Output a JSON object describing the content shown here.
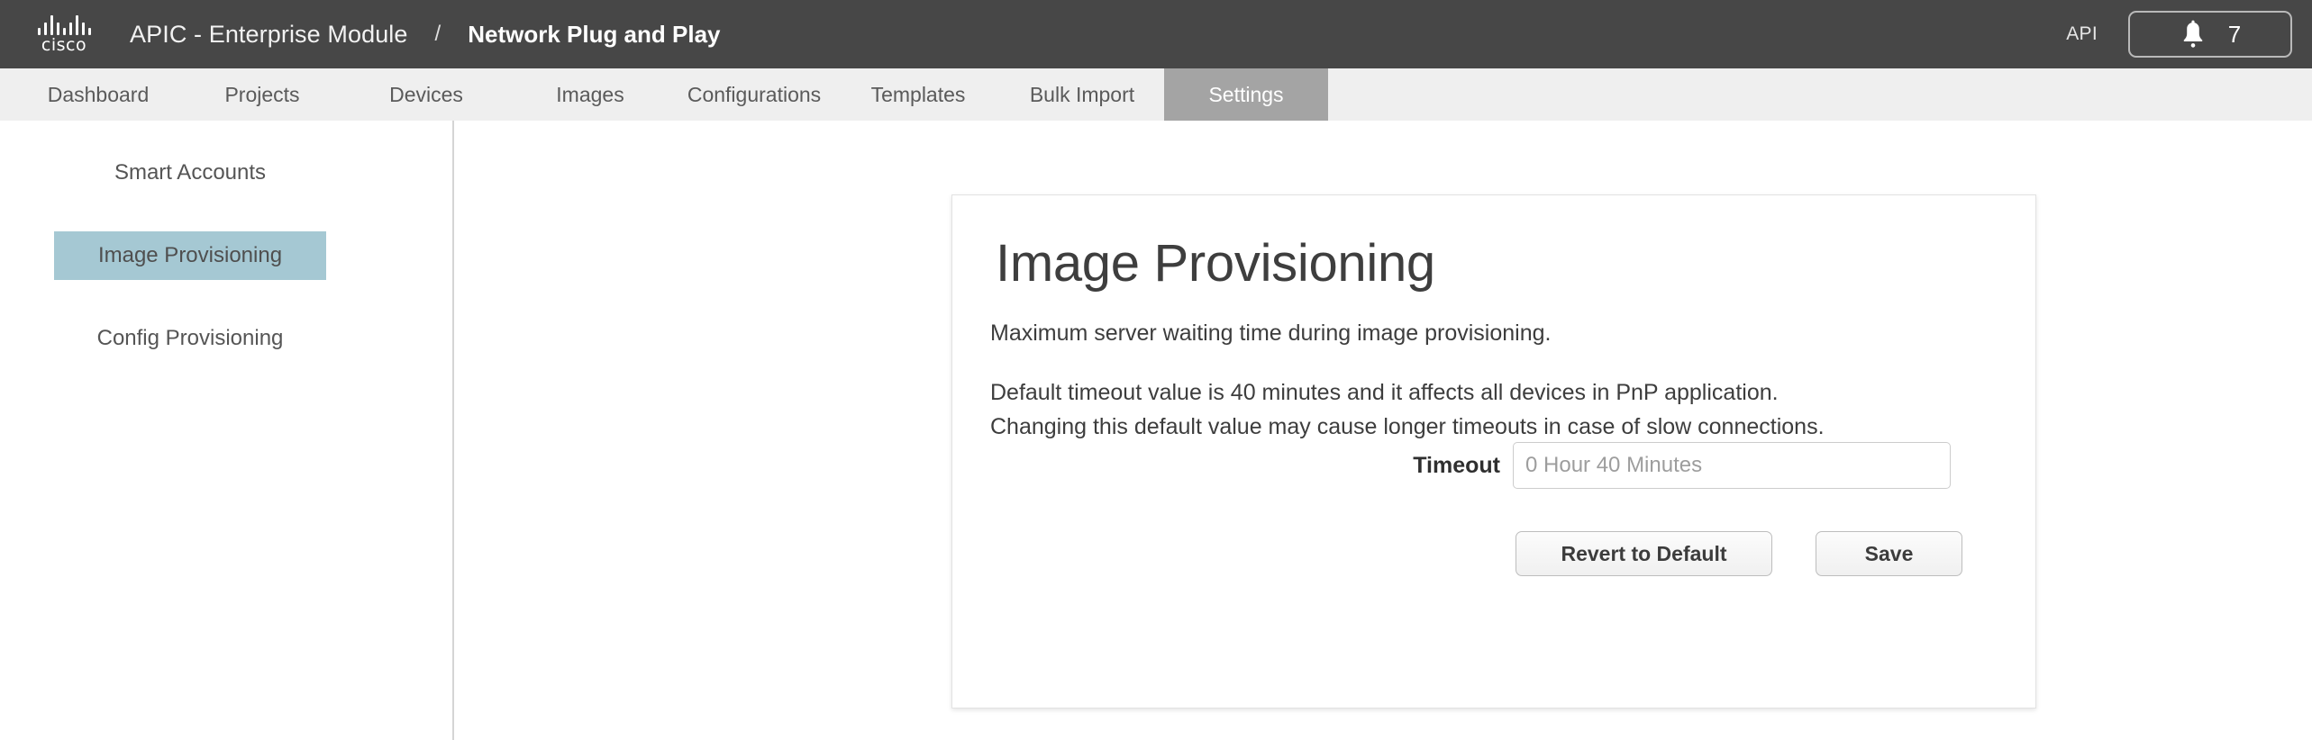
{
  "header": {
    "logo_wordmark": "cisco",
    "logo_icon": "cisco-logo-icon",
    "app_title": "APIC - Enterprise Module",
    "breadcrumb_separator": "/",
    "section_title": "Network Plug and Play",
    "api_label": "API",
    "notification_icon": "bell-icon",
    "notification_count": "7"
  },
  "nav": {
    "tabs": [
      {
        "label": "Dashboard",
        "active": false
      },
      {
        "label": "Projects",
        "active": false
      },
      {
        "label": "Devices",
        "active": false
      },
      {
        "label": "Images",
        "active": false
      },
      {
        "label": "Configurations",
        "active": false
      },
      {
        "label": "Templates",
        "active": false
      },
      {
        "label": "Bulk Import",
        "active": false
      },
      {
        "label": "Settings",
        "active": true
      }
    ]
  },
  "sidebar": {
    "items": [
      {
        "label": "Smart Accounts",
        "active": false
      },
      {
        "label": "Image Provisioning",
        "active": true
      },
      {
        "label": "Config Provisioning",
        "active": false
      }
    ]
  },
  "main": {
    "card": {
      "title": "Image Provisioning",
      "description_1": "Maximum server waiting time during image provisioning.",
      "description_2_line_1": "Default timeout value is 40 minutes and it affects all devices in PnP application.",
      "description_2_line_2": "Changing this default value may cause longer timeouts in case of slow connections.",
      "timeout_label": "Timeout",
      "timeout_value": "",
      "timeout_placeholder": "0 Hour 40 Minutes",
      "revert_button_label": "Revert to Default",
      "save_button_label": "Save"
    }
  },
  "colors": {
    "header_bg": "#474747",
    "nav_bg": "#efefef",
    "active_tab_bg": "#a4a4a4",
    "sidebar_active_bg": "#a5c8d3",
    "text_dark": "#3d3d3d"
  }
}
